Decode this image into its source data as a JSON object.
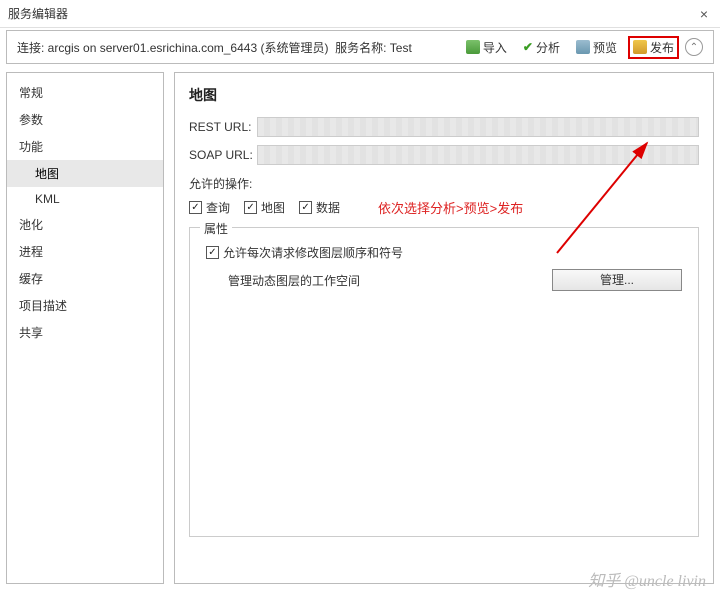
{
  "window": {
    "title": "服务编辑器",
    "close": "×"
  },
  "toolbar": {
    "connection_prefix": "连接: ",
    "connection": "arcgis on server01.esrichina.com_6443 (系统管理员)",
    "service_name_prefix": "服务名称: ",
    "service_name": "Test",
    "import": "导入",
    "analyze": "分析",
    "preview": "预览",
    "publish": "发布",
    "collapse": "⌃"
  },
  "sidebar": {
    "items": [
      {
        "label": "常规"
      },
      {
        "label": "参数"
      },
      {
        "label": "功能"
      },
      {
        "label": "地图",
        "sub": true,
        "active": true
      },
      {
        "label": "KML",
        "sub": true
      },
      {
        "label": "池化"
      },
      {
        "label": "进程"
      },
      {
        "label": "缓存"
      },
      {
        "label": "项目描述"
      },
      {
        "label": "共享"
      }
    ]
  },
  "content": {
    "heading": "地图",
    "rest_label": "REST URL:",
    "soap_label": "SOAP URL:",
    "allowed_ops_label": "允许的操作:",
    "checks": {
      "query": "查询",
      "map": "地图",
      "data": "数据"
    },
    "annotation": "依次选择分析>预览>发布",
    "fieldset": {
      "legend": "属性",
      "allow_reorder": "允许每次请求修改图层顺序和符号",
      "manage_workspace": "管理动态图层的工作空间",
      "manage_btn": "管理..."
    }
  },
  "watermark": "知乎 @uncle livin"
}
